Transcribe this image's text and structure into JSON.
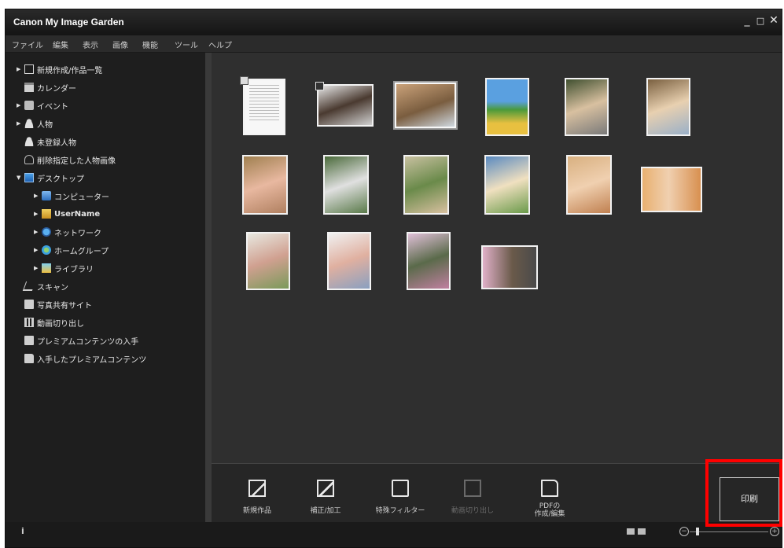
{
  "window": {
    "title": "Canon My Image Garden",
    "controls": [
      "_",
      "□",
      "✕"
    ]
  },
  "menu": [
    "ファイル",
    "編集",
    "表示",
    "画像",
    "機能",
    "ツール",
    "ヘルプ"
  ],
  "sidebar": {
    "items": [
      {
        "label": "新規作成/作品一覧",
        "icon": "new-document-icon",
        "expandable": true
      },
      {
        "label": "カレンダー",
        "icon": "calendar-icon",
        "expandable": false
      },
      {
        "label": "イベント",
        "icon": "event-icon",
        "expandable": true
      },
      {
        "label": "人物",
        "icon": "person-icon",
        "expandable": true
      },
      {
        "label": "未登録人物",
        "icon": "unregistered-person-icon",
        "expandable": false
      },
      {
        "label": "削除指定した人物画像",
        "icon": "deleted-person-icon",
        "expandable": false
      },
      {
        "label": "デスクトップ",
        "icon": "desktop-icon",
        "expandable": true,
        "expanded": true
      },
      {
        "label": "コンピューター",
        "icon": "computer-icon",
        "expandable": true,
        "indent": 1
      },
      {
        "label": "UserName",
        "icon": "user-folder-icon",
        "expandable": true,
        "indent": 1
      },
      {
        "label": "ネットワーク",
        "icon": "network-icon",
        "expandable": true,
        "indent": 1
      },
      {
        "label": "ホームグループ",
        "icon": "homegroup-icon",
        "expandable": true,
        "indent": 1
      },
      {
        "label": "ライブラリ",
        "icon": "library-icon",
        "expandable": true,
        "indent": 1
      },
      {
        "label": "スキャン",
        "icon": "scan-icon",
        "expandable": false
      },
      {
        "label": "写真共有サイト",
        "icon": "photo-share-icon",
        "expandable": false
      },
      {
        "label": "動画切り出し",
        "icon": "video-capture-icon",
        "expandable": false
      },
      {
        "label": "プレミアムコンテンツの入手",
        "icon": "premium-content-icon",
        "expandable": false
      },
      {
        "label": "入手したプレミアムコンテンツ",
        "icon": "folder-icon",
        "expandable": false
      }
    ]
  },
  "toolbar": {
    "buttons": [
      {
        "label": "新規作品",
        "icon": "new-item-icon",
        "enabled": true
      },
      {
        "label": "補正/加工",
        "icon": "correct-edit-icon",
        "enabled": true
      },
      {
        "label": "特殊フィルター",
        "icon": "special-filter-icon",
        "enabled": true
      },
      {
        "label": "動画切り出し",
        "icon": "video-frame-icon",
        "enabled": false
      },
      {
        "label": "PDFの\n作成/編集",
        "icon": "pdf-icon",
        "enabled": true
      }
    ],
    "print_label": "印刷"
  },
  "status": {
    "info": "i"
  },
  "accent": "#ff0000"
}
